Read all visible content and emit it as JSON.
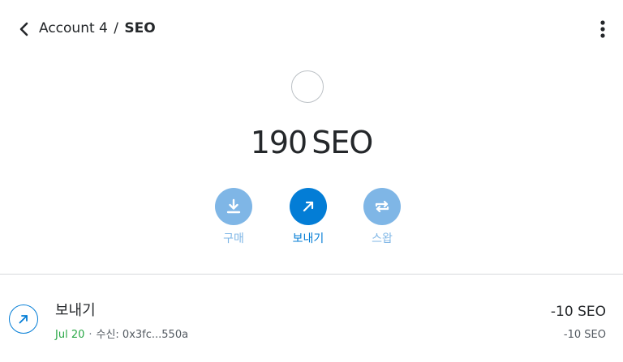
{
  "header": {
    "account": "Account 4",
    "separator": "/",
    "token": "SEO"
  },
  "overview": {
    "balance_value": "190",
    "balance_unit": "SEO"
  },
  "actions": {
    "buy_label": "구매",
    "send_label": "보내기",
    "swap_label": "스왑"
  },
  "transactions": [
    {
      "title": "보내기",
      "date": "Jul 20",
      "bullet": "·",
      "detail": "수신: 0x3fc...550a",
      "amount": "-10 SEO",
      "amount_secondary": "-10 SEO"
    }
  ],
  "colors": {
    "primary": "#037dd6",
    "primary_disabled": "#7fb6e6",
    "success": "#28a745",
    "text": "#24272a",
    "divider": "#d6d9dc"
  },
  "icons": {
    "back": "chevron-left-icon",
    "menu": "vertical-dots-icon",
    "buy": "download-icon",
    "send": "arrow-up-right-icon",
    "swap": "swap-arrows-icon",
    "tx": "arrow-up-right-icon"
  }
}
